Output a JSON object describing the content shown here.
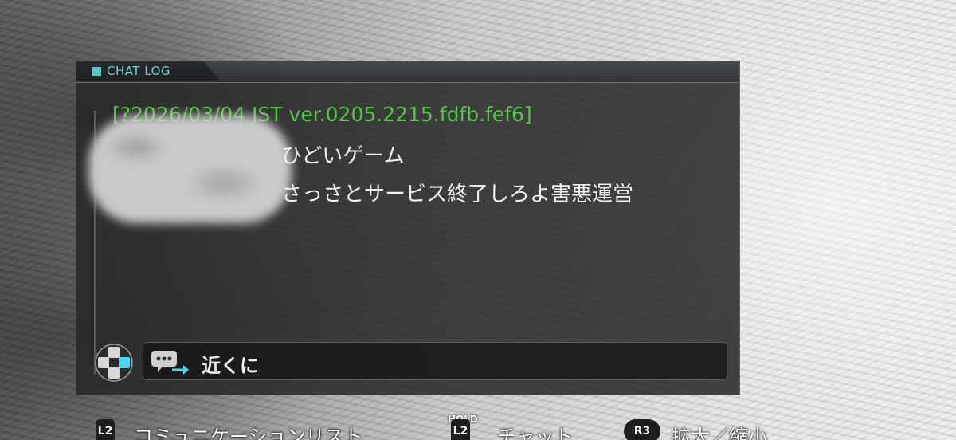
{
  "chat_log": {
    "header_title": "CHAT LOG",
    "system_line": "[?2026/03/04 JST ver.0205.2215.fdfb.fef6]",
    "messages": [
      {
        "text": "ひどいゲーム"
      },
      {
        "text": "さっさとサービス終了しろよ害悪運営"
      }
    ],
    "input": {
      "mode_label": "近くに",
      "icon": "chat-bubble-arrow-icon"
    },
    "dpad_icon": "dpad-icon"
  },
  "hints": [
    {
      "button": "L2",
      "label": "コミュニケーションリスト"
    },
    {
      "button": "L2",
      "modifier": "HOLD",
      "label": "チャット"
    },
    {
      "button": "R3",
      "label": "拡大／縮小"
    }
  ],
  "colors": {
    "system_text": "#58c24a",
    "header_accent": "#6fd0c8",
    "message_text": "#f0f0f0"
  }
}
